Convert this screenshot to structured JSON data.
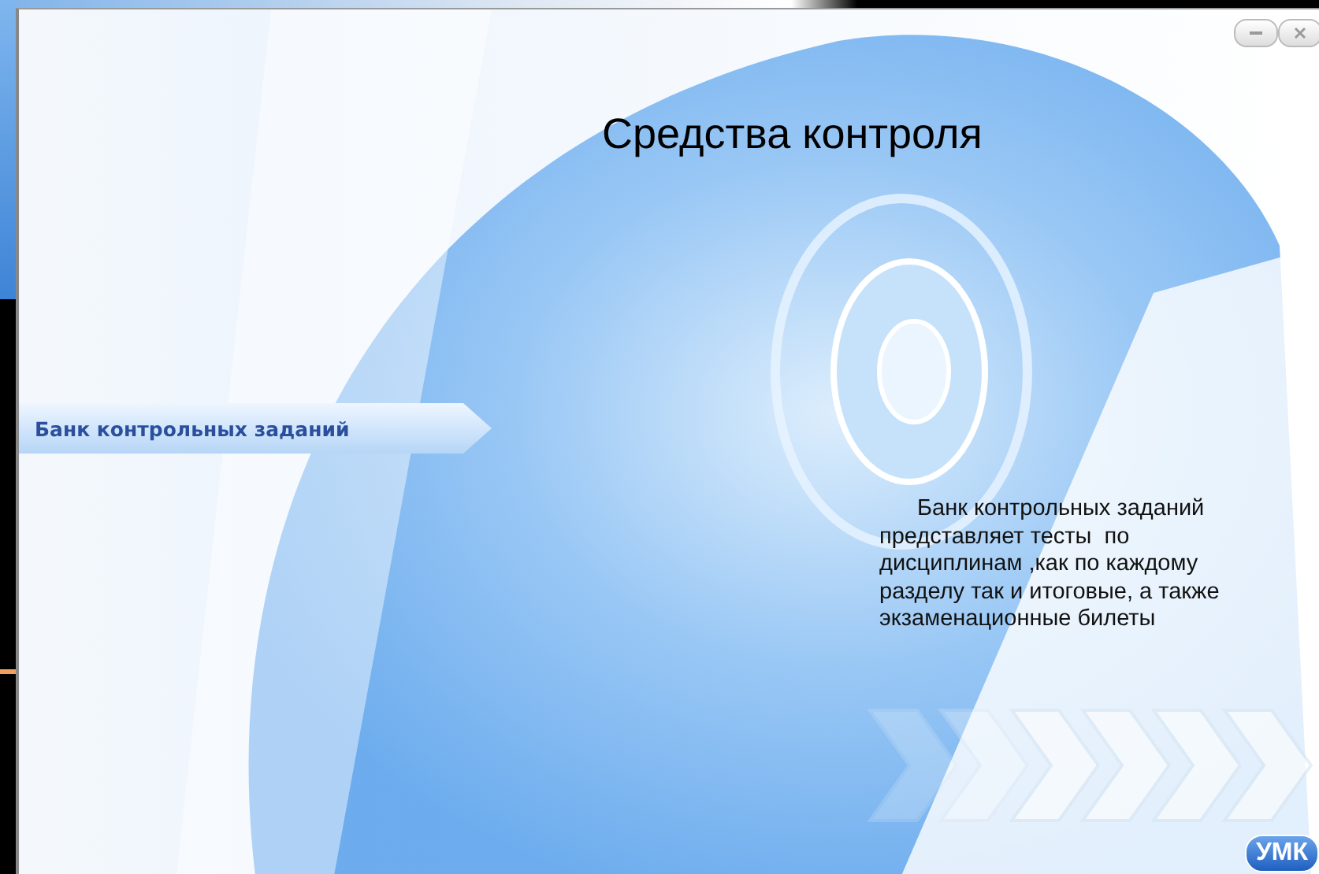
{
  "heading": "Средства контроля",
  "menu": [
    {
      "label": "Банк контрольных заданий",
      "selected": true
    }
  ],
  "description": "Банк контрольных заданий представляет тесты  по дисциплинам ,как по каждому разделу так и итоговые, а также экзаменационные билеты",
  "badge": "УМК"
}
